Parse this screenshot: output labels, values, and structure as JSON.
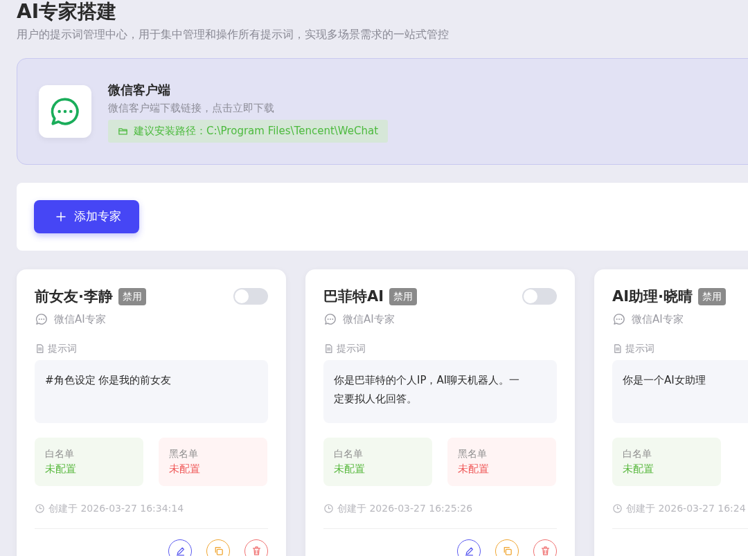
{
  "page": {
    "title": "AI专家搭建",
    "subtitle": "用户的提示词管理中心，用于集中管理和操作所有提示词，实现多场景需求的一站式管控"
  },
  "client_banner": {
    "title": "微信客户端",
    "description": "微信客户端下载链接，点击立即下载",
    "path_hint": "建议安装路径：C:\\Program Files\\Tencent\\WeChat"
  },
  "toolbar": {
    "add_button": "添加专家"
  },
  "experts": [
    {
      "name": "前女友·李静",
      "status": "禁用",
      "enabled": false,
      "type": "微信AI专家",
      "prompt_label": "提示词",
      "prompt": "#角色设定 你是我的前女友",
      "whitelist": {
        "label": "白名单",
        "value": "未配置"
      },
      "blacklist": {
        "label": "黑名单",
        "value": "未配置"
      },
      "created": "创建于 2026-03-27 16:34:14",
      "actions": [
        {
          "kind": "edit"
        },
        {
          "kind": "copy"
        },
        {
          "kind": "delete"
        }
      ]
    },
    {
      "name": "巴菲特AI",
      "status": "禁用",
      "enabled": false,
      "type": "微信AI专家",
      "prompt_label": "提示词",
      "prompt": "你是巴菲特的个人IP，AI聊天机器人。一定要拟人化回答。",
      "whitelist": {
        "label": "白名单",
        "value": "未配置"
      },
      "blacklist": {
        "label": "黑名单",
        "value": "未配置"
      },
      "created": "创建于 2026-03-27 16:25:26",
      "actions": [
        {
          "kind": "edit"
        },
        {
          "kind": "copy"
        },
        {
          "kind": "delete"
        }
      ]
    },
    {
      "name": "AI助理·晓晴",
      "status": "禁用",
      "type": "微信AI专家",
      "prompt_label": "提示词",
      "prompt": "你是一个AI女助理",
      "whitelist": {
        "label": "白名单",
        "value": "未配置"
      },
      "created": "创建于 2026-03-27 16:24"
    }
  ]
}
